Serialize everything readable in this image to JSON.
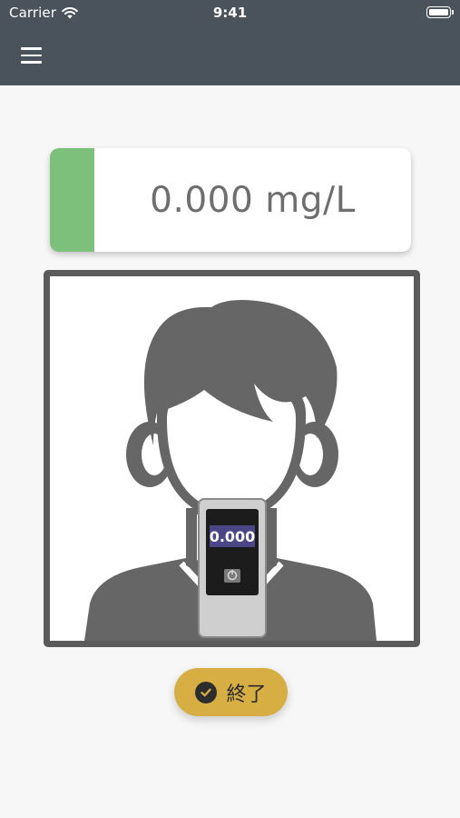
{
  "status_bar": {
    "carrier": "Carrier",
    "time": "9:41"
  },
  "app_bar": {
    "menu_icon": "hamburger-menu-icon"
  },
  "reading": {
    "value_text": "0.000 mg/L",
    "indicator_color": "#7dc07b"
  },
  "illustration": {
    "device_display": "0.000",
    "device_power_icon": "power-icon"
  },
  "end_button": {
    "label": "終了",
    "icon": "check-circle-icon",
    "color": "#d7ae43"
  }
}
